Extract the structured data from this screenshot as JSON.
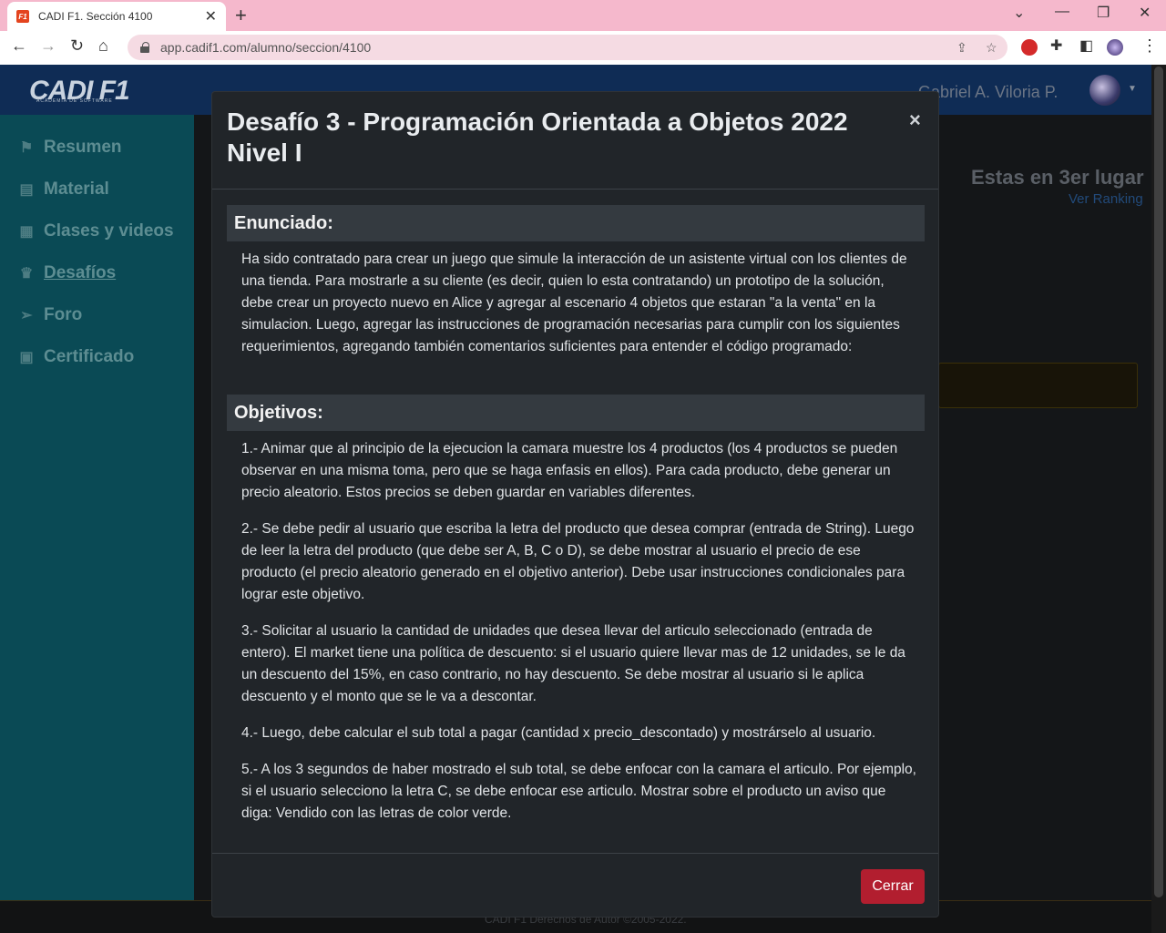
{
  "browser": {
    "tab_title": "CADI F1. Sección 4100",
    "tab_favicon_text": "F1",
    "url": "app.cadif1.com/alumno/seccion/4100"
  },
  "app": {
    "logo_text": "CADI F1",
    "logo_sub": "ACADEMIA DE SOFTWARE",
    "user_name": "Gabriel A. Viloria P.",
    "sidebar": [
      {
        "label": "Resumen",
        "icon": "flag-icon"
      },
      {
        "label": "Material",
        "icon": "book-icon"
      },
      {
        "label": "Clases y videos",
        "icon": "calendar-icon"
      },
      {
        "label": "Desafíos",
        "icon": "trophy-icon"
      },
      {
        "label": "Foro",
        "icon": "paper-plane-icon"
      },
      {
        "label": "Certificado",
        "icon": "certificate-icon"
      }
    ],
    "rank_text": "Estas en 3er lugar",
    "rank_link": "Ver Ranking",
    "footer": "CADI F1 Derechos de Autor ©2005-2022."
  },
  "modal": {
    "title": "Desafío 3 - Programación Orientada a Objetos 2022 Nivel I",
    "close_x": "×",
    "enunciado_heading": "Enunciado:",
    "enunciado_text": "Ha sido contratado para crear un juego que simule la interacción de un asistente virtual con los clientes de una tienda. Para mostrarle a su cliente (es decir, quien lo esta contratando) un prototipo de la solución, debe crear un proyecto nuevo en Alice y agregar al escenario 4 objetos que estaran \"a la venta\" en la simulacion. Luego, agregar las instrucciones de programación necesarias para cumplir con los siguientes requerimientos, agregando también comentarios suficientes para entender el código programado:",
    "objetivos_heading": "Objetivos:",
    "objetivos": [
      "1.- Animar que al principio de la ejecucion la camara muestre los 4 productos (los 4 productos se pueden observar en una misma toma, pero que se haga enfasis en ellos). Para cada producto, debe generar un precio aleatorio. Estos precios se deben guardar en variables diferentes.",
      "2.- Se debe pedir al usuario que escriba la letra del producto que desea comprar (entrada de String). Luego de leer la letra del producto (que debe ser A, B, C o D), se debe mostrar al usuario el precio de ese producto (el precio aleatorio generado en el objetivo anterior). Debe usar instrucciones condicionales para lograr este objetivo.",
      "3.- Solicitar al usuario la cantidad de unidades que desea llevar del articulo seleccionado (entrada de entero). El market tiene una política de descuento: si el usuario quiere llevar mas de 12 unidades, se le da un descuento del 15%, en caso contrario, no hay descuento. Se debe mostrar al usuario si le aplica descuento y el monto que se le va a descontar.",
      "4.- Luego, debe calcular el sub total a pagar (cantidad x precio_descontado) y mostrárselo al usuario.",
      "5.- A los 3 segundos de haber mostrado el sub total, se debe enfocar con la camara el articulo. Por ejemplo, si el usuario selecciono la letra C, se debe enfocar ese articulo. Mostrar sobre el producto un aviso que diga: Vendido con las letras de color verde."
    ],
    "close_button": "Cerrar"
  }
}
